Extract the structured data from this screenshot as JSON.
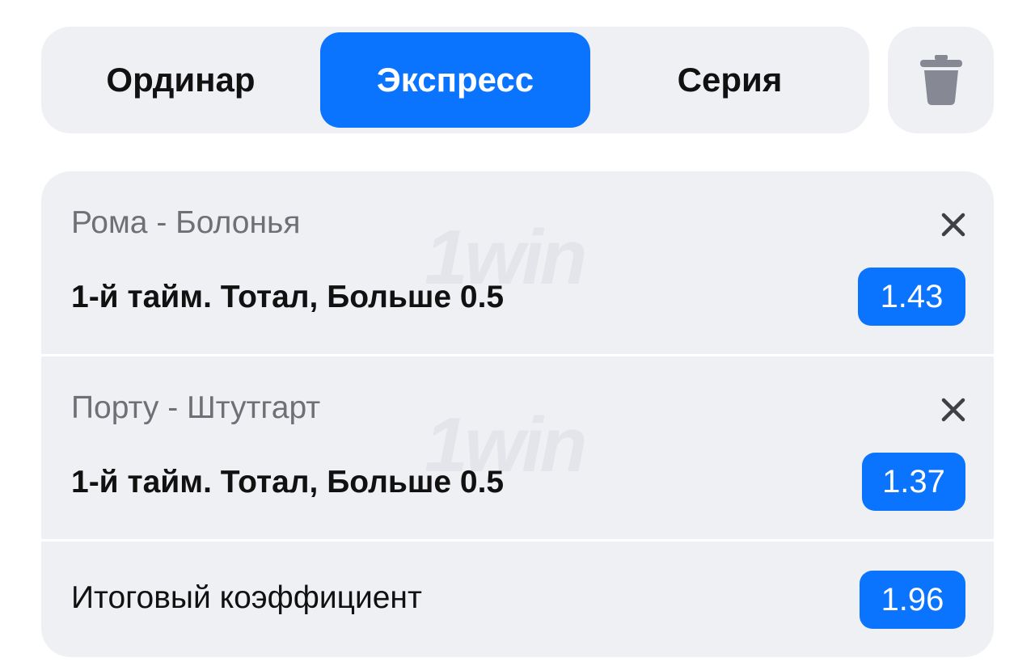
{
  "colors": {
    "accent": "#0a74ff",
    "panel": "#eff0f4",
    "icon_gray": "#868893"
  },
  "tabs": [
    {
      "label": "Ординар",
      "active": false
    },
    {
      "label": "Экспресс",
      "active": true
    },
    {
      "label": "Серия",
      "active": false
    }
  ],
  "trash_icon": "trash-icon",
  "watermark": "1win",
  "bets": [
    {
      "match": "Рома - Болонья",
      "market": "1-й тайм. Тотал, Больше 0.5",
      "odd": "1.43",
      "close_icon": "close-icon"
    },
    {
      "match": "Порту - Штутгарт",
      "market": "1-й тайм. Тотал, Больше 0.5",
      "odd": "1.37",
      "close_icon": "close-icon"
    }
  ],
  "total": {
    "label": "Итоговый коэффициент",
    "odd": "1.96"
  }
}
